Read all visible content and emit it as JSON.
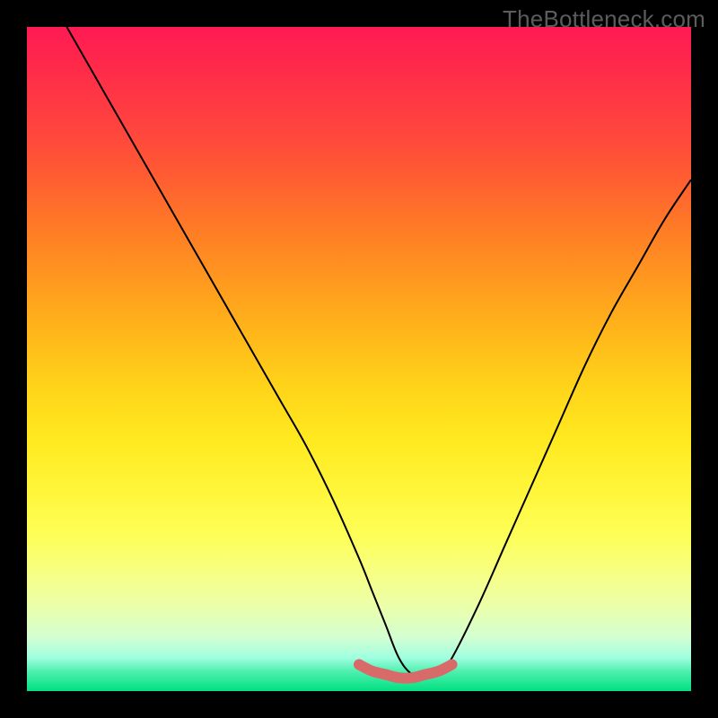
{
  "watermark": "TheBottleneck.com",
  "chart_data": {
    "type": "line",
    "title": "",
    "xlabel": "",
    "ylabel": "",
    "xlim": [
      0,
      100
    ],
    "ylim": [
      0,
      100
    ],
    "curve_x": [
      6,
      10,
      14,
      18,
      22,
      26,
      30,
      34,
      38,
      42,
      46,
      50,
      52,
      54,
      56,
      58,
      60,
      62,
      64,
      68,
      72,
      76,
      80,
      84,
      88,
      92,
      96,
      100
    ],
    "curve_y": [
      100,
      93,
      86,
      79,
      72,
      65,
      58,
      51,
      44,
      37,
      29,
      20,
      15,
      10,
      5,
      2.5,
      2,
      2.5,
      5,
      13,
      22,
      31,
      40,
      49,
      57,
      64,
      71,
      77
    ],
    "valley_x": [
      50,
      52,
      54,
      56,
      58,
      60,
      62,
      64
    ],
    "valley_y": [
      4,
      3,
      2.5,
      2,
      2,
      2.5,
      3,
      4
    ],
    "colors": {
      "curve": "#000000",
      "valley_marker": "#d86a6a",
      "background_top": "#ff1a53",
      "background_bottom": "#00e080",
      "frame": "#000000"
    }
  }
}
